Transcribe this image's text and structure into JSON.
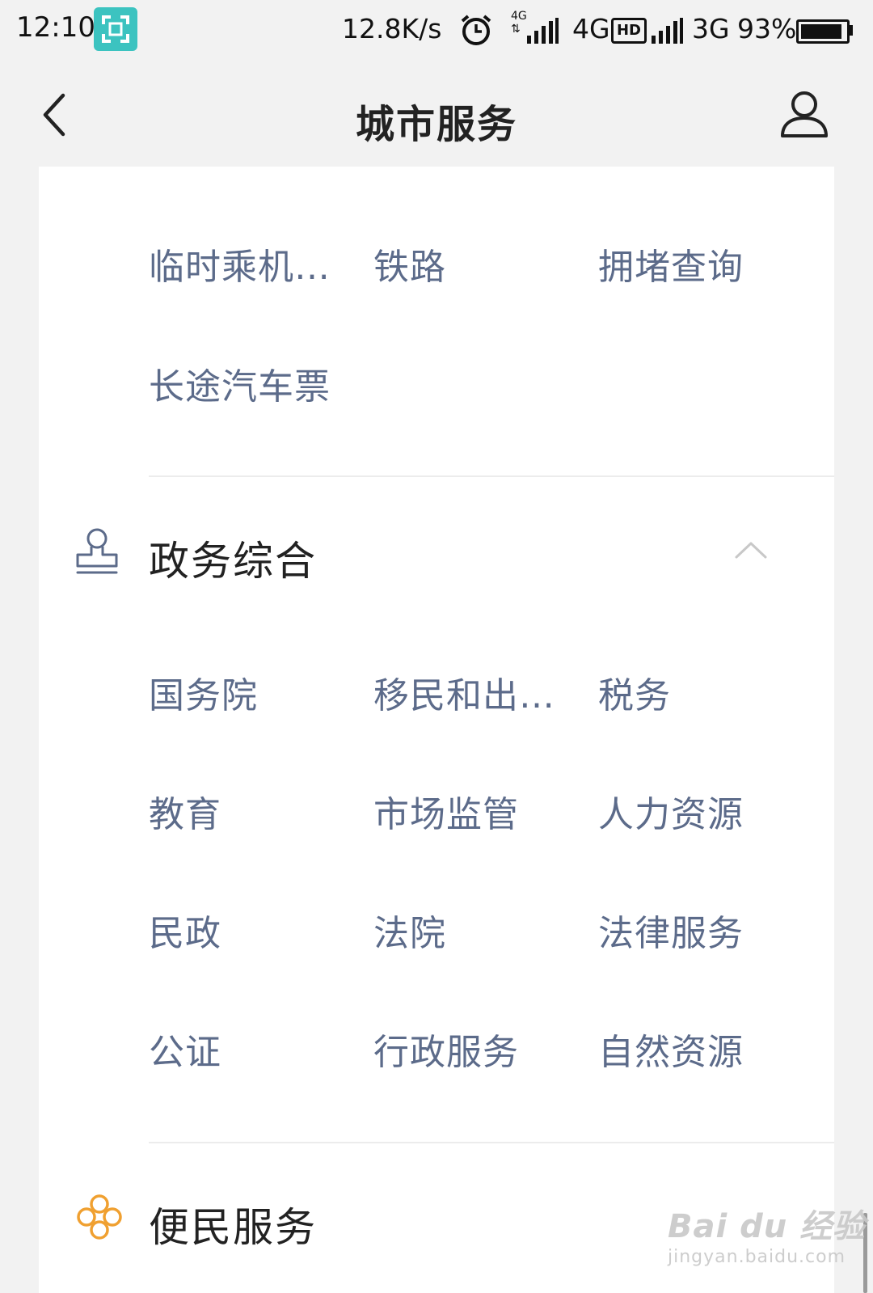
{
  "status_bar": {
    "time": "12:10",
    "network_speed": "12.8K/s",
    "volte_label": "4G",
    "network_1": "4G",
    "hd_label": "HD",
    "network_2": "3G",
    "battery_percent": "93%",
    "battery_level": 0.93,
    "icons": [
      "screen-scan-icon",
      "alarm-icon",
      "signal-icon",
      "signal-icon",
      "battery-icon"
    ]
  },
  "nav": {
    "title": "城市服务",
    "back_icon": "back-arrow-icon",
    "user_icon": "user-profile-icon"
  },
  "sections": {
    "transport": {
      "items": [
        "临时乘机…",
        "铁路",
        "拥堵查询",
        "长途汽车票"
      ]
    },
    "government": {
      "title": "政务综合",
      "icon": "government-stamp-icon",
      "expanded": true,
      "items": [
        "国务院",
        "移民和出…",
        "税务",
        "教育",
        "市场监管",
        "人力资源",
        "民政",
        "法院",
        "法律服务",
        "公证",
        "行政服务",
        "自然资源"
      ]
    },
    "convenience": {
      "title": "便民服务",
      "icon": "convenience-knot-icon",
      "icon_color": "#f0a030"
    }
  },
  "colors": {
    "item_text": "#5c6b8a",
    "title_text": "#222222",
    "background": "#f2f2f2",
    "card": "#ffffff",
    "scan_badge": "#3cc3c0"
  },
  "watermark": {
    "main": "Bai du 经验",
    "sub": "jingyan.baidu.com"
  }
}
